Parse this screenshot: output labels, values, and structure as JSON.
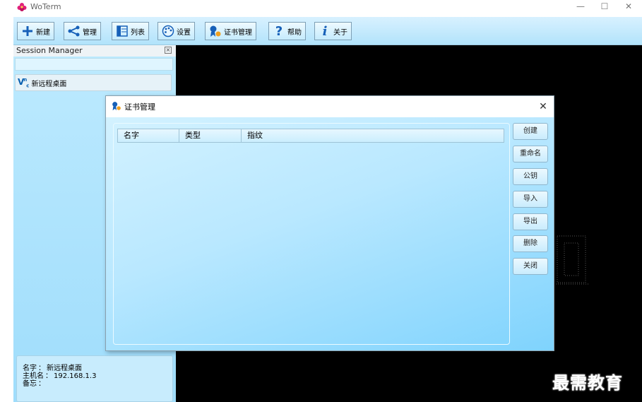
{
  "app": {
    "title": "WoTerm"
  },
  "window_controls": {
    "minimize": "—",
    "maximize": "☐",
    "close": "✕"
  },
  "toolbar": [
    {
      "id": "new",
      "label": "新建",
      "icon": "plus-icon"
    },
    {
      "id": "manage",
      "label": "管理",
      "icon": "share-icon"
    },
    {
      "id": "list",
      "label": "列表",
      "icon": "list-panel-icon"
    },
    {
      "id": "settings",
      "label": "设置",
      "icon": "palette-icon"
    },
    {
      "id": "cert",
      "label": "证书管理",
      "icon": "certificate-icon"
    },
    {
      "id": "help",
      "label": "帮助",
      "icon": "question-icon"
    },
    {
      "id": "about",
      "label": "关于",
      "icon": "info-icon"
    }
  ],
  "session_manager": {
    "title": "Session Manager",
    "search_value": "",
    "items": [
      {
        "type": "VNC",
        "label": "新远程桌面"
      }
    ],
    "details": {
      "name_label": "名字",
      "name_value": "新远程桌面",
      "host_label": "主机名",
      "host_value": "192.168.1.3",
      "note_label": "备忘",
      "note_value": ""
    }
  },
  "dialog": {
    "title": "证书管理",
    "close": "✕",
    "columns": [
      "名字",
      "类型",
      "指纹"
    ],
    "buttons": [
      "创建",
      "重命名",
      "公钥",
      "导入",
      "导出",
      "删除",
      "关闭"
    ]
  },
  "watermark": "最需教育",
  "colors": {
    "accent": "#0a60b0",
    "terminal_bg": "#000000",
    "toolbar_bg": "#c5ebfd",
    "panel_bg": "#b2e6fd"
  }
}
